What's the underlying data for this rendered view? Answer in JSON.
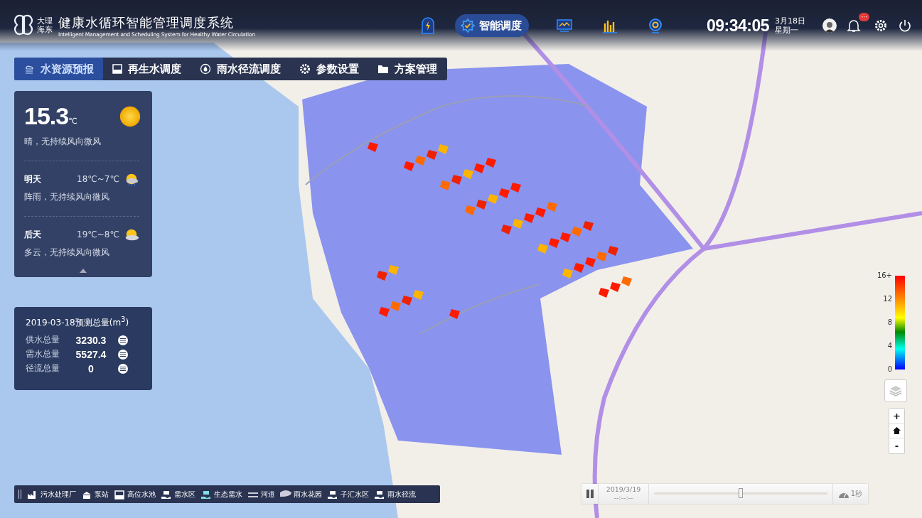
{
  "header": {
    "logo_place_top": "大理",
    "logo_place_bottom": "海东",
    "title": "健康水循环智能管理调度系统",
    "subtitle": "Intelligent Management and Scheduling System for Healthy Water Circulation"
  },
  "top_nav": [
    {
      "selected": false
    },
    {
      "label": "智能调度",
      "selected": true
    },
    {
      "selected": false
    },
    {
      "selected": false
    },
    {
      "selected": false
    }
  ],
  "clock": {
    "time": "09:34:05",
    "date": "3月18日",
    "weekday": "星期一"
  },
  "notifications": {
    "badge": "···"
  },
  "tabs": [
    {
      "label": "水资源预报",
      "selected": true
    },
    {
      "label": "再生水调度",
      "selected": false
    },
    {
      "label": "雨水径流调度",
      "selected": false
    },
    {
      "label": "参数设置",
      "selected": false
    },
    {
      "label": "方案管理",
      "selected": false
    }
  ],
  "weather": {
    "temperature": "15.3",
    "unit": "℃",
    "description": "晴，无持续风向微风",
    "forecast": [
      {
        "day": "明天",
        "range": "18℃~7℃",
        "description": "阵雨，无持续风向微风"
      },
      {
        "day": "后天",
        "range": "19℃~8℃",
        "description": "多云，无持续风向微风"
      }
    ],
    "expanded": true
  },
  "totals": {
    "title": "2019-03-18预测总量(m$^{3}$)",
    "rows": [
      {
        "label": "供水总量",
        "value": "3230.3"
      },
      {
        "label": "需水总量",
        "value": "5527.4"
      },
      {
        "label": "径流总量",
        "value": "0"
      }
    ]
  },
  "layer_legend": [
    "污水处理厂",
    "泵站",
    "高位水池",
    "需水区",
    "生态需水",
    "河道",
    "雨水花园",
    "子汇水区",
    "雨水径流"
  ],
  "timeline": {
    "date": "2019/3/19",
    "time": "--:--:--",
    "level": 0.5,
    "speed": "1秒",
    "playing": true
  },
  "color_scale": {
    "ticks": [
      "16+",
      "12",
      "8",
      "4",
      "0"
    ]
  },
  "zoom_controls": {
    "plus": "+",
    "minus": "-"
  }
}
